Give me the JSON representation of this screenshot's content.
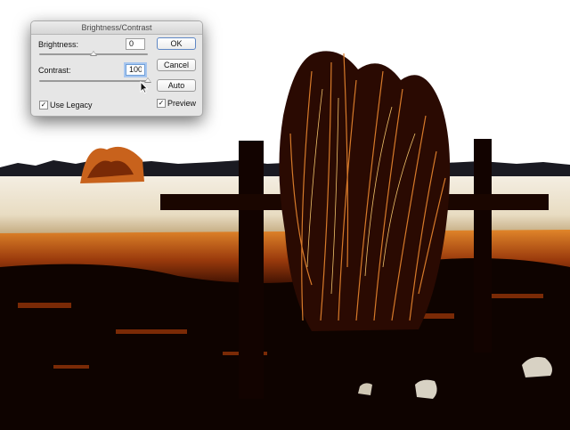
{
  "dialog": {
    "title": "Brightness/Contrast",
    "brightness": {
      "label": "Brightness:",
      "value": "0",
      "slider_level": 0.5
    },
    "contrast": {
      "label": "Contrast:",
      "value": "100",
      "slider_level": 1.0
    },
    "buttons": {
      "ok": "OK",
      "cancel": "Cancel",
      "auto": "Auto"
    },
    "use_legacy": {
      "label": "Use Legacy",
      "checked": true,
      "mark": "✓"
    },
    "preview": {
      "label": "Preview",
      "checked": true,
      "mark": "✓"
    }
  },
  "colors": {
    "sky": "#ffffff",
    "field": "#f2ead8",
    "grass_orange": "#c8621c",
    "dark_ground": "#0e0300",
    "dialog_bg": "#e6e6e6",
    "focus_ring": "#a7c6ef"
  },
  "icons": {
    "cursor": "arrow-cursor-icon"
  }
}
